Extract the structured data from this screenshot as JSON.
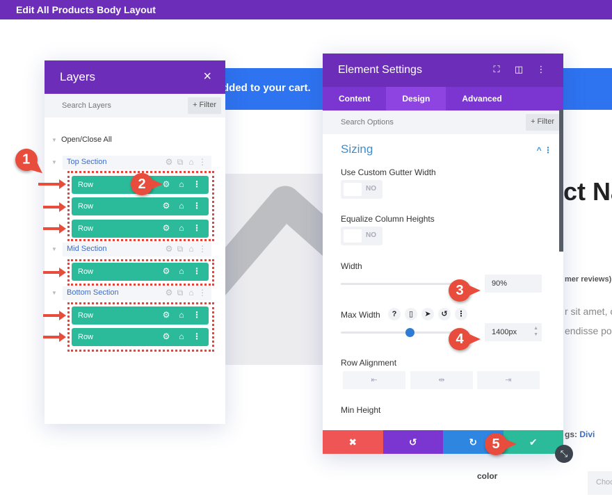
{
  "topbar": {
    "title": "Edit All Products Body Layout"
  },
  "background": {
    "cart_message": "dded to your cart.",
    "product_title": "ct Na",
    "reviews": "mer reviews)",
    "lorem1": "r sit amet, c",
    "lorem2": "endisse po",
    "tags_label": "gs: ",
    "tags_link": "Divi",
    "color_label": "color",
    "choose_button": "Choo"
  },
  "layers": {
    "title": "Layers",
    "close_icon": "×",
    "search_placeholder": "Search Layers",
    "filter_label": "+ Filter",
    "open_close_all": "Open/Close All",
    "sections": [
      {
        "name": "Top Section",
        "rows": [
          "Row",
          "Row",
          "Row"
        ]
      },
      {
        "name": "Mid Section",
        "rows": [
          "Row"
        ]
      },
      {
        "name": "Bottom Section",
        "rows": [
          "Row",
          "Row"
        ]
      }
    ],
    "icons": {
      "gear": "⚙",
      "duplicate": "⧉",
      "trash": "🗑",
      "more": "⋮",
      "triangle": "▼"
    }
  },
  "markers": [
    "1",
    "2",
    "3",
    "4",
    "5"
  ],
  "settings": {
    "title": "Element Settings",
    "header_icons": [
      "⛶",
      "◫",
      "⋮"
    ],
    "tabs": [
      {
        "label": "Content",
        "active": false
      },
      {
        "label": "Design",
        "active": true
      },
      {
        "label": "Advanced",
        "active": false
      }
    ],
    "search_placeholder": "Search Options",
    "filter_label": "+ Filter",
    "group_title": "Sizing",
    "group_icons": "^ ⋮",
    "fields": {
      "custom_gutter": {
        "label": "Use Custom Gutter Width",
        "value": "NO"
      },
      "equalize": {
        "label": "Equalize Column Heights",
        "value": "NO"
      },
      "width": {
        "label": "Width",
        "value": "90%",
        "slider_fraction": 1.0
      },
      "max_width": {
        "label": "Max Width",
        "value": "1400px",
        "slider_fraction": 0.58,
        "icons": [
          "?",
          "▯",
          "➤",
          "↺",
          "⋮"
        ]
      },
      "row_alignment": {
        "label": "Row Alignment",
        "options": [
          "⇤",
          "⇹",
          "⇥"
        ]
      },
      "min_height": {
        "label": "Min Height"
      }
    },
    "footer": {
      "cancel": "✖",
      "undo": "↺",
      "redo": "↻",
      "save": "✔"
    },
    "colors": {
      "cancel": "#ef5555",
      "undo": "#7b35d0",
      "redo": "#2e86e0",
      "save": "#2bbb9a"
    }
  },
  "resize_icon": "⤡"
}
